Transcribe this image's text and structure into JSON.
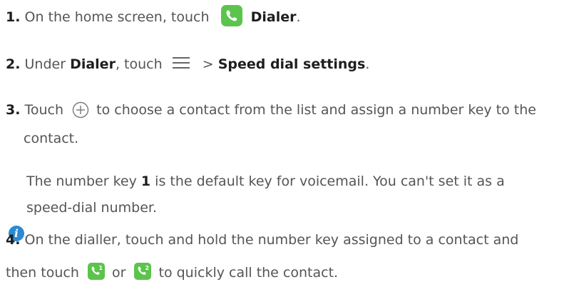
{
  "steps": [
    {
      "number": "1.",
      "text_before": "On the home screen, touch",
      "icon": "dialer-app-icon",
      "bold": "Dialer",
      "text_after": "."
    },
    {
      "number": "2.",
      "text_before": "Under",
      "bold_1": "Dialer",
      "text_middle": ", touch",
      "icon": "menu-icon",
      "separator": ">",
      "bold_2": "Speed dial settings",
      "text_after": "."
    },
    {
      "number": "3.",
      "text_before": "Touch",
      "icon": "add-circle-icon",
      "line_1": "to choose a contact from the list and assign a number key to the",
      "line_2": "contact."
    },
    {
      "number": "4.",
      "line_1": "On the dialler, touch and hold the number key assigned to a contact and",
      "text_before": "then touch",
      "icon_1": "speed-dial-1-icon",
      "icon_1_digit": "1",
      "text_middle": "or",
      "icon_2": "speed-dial-2-icon",
      "icon_2_digit": "2",
      "text_after": "to quickly call the contact."
    }
  ],
  "note": {
    "icon": "info-icon",
    "icon_glyph": "i",
    "text_before": "The number key",
    "bold": "1",
    "line_1_rest": "is the default key for voicemail. You can't set it as a",
    "line_2": "speed-dial number."
  },
  "colors": {
    "text": "#555555",
    "bold_text": "#1e1e1e",
    "dialer_green": "#5cc44c",
    "info_blue": "#2a8ad4"
  }
}
